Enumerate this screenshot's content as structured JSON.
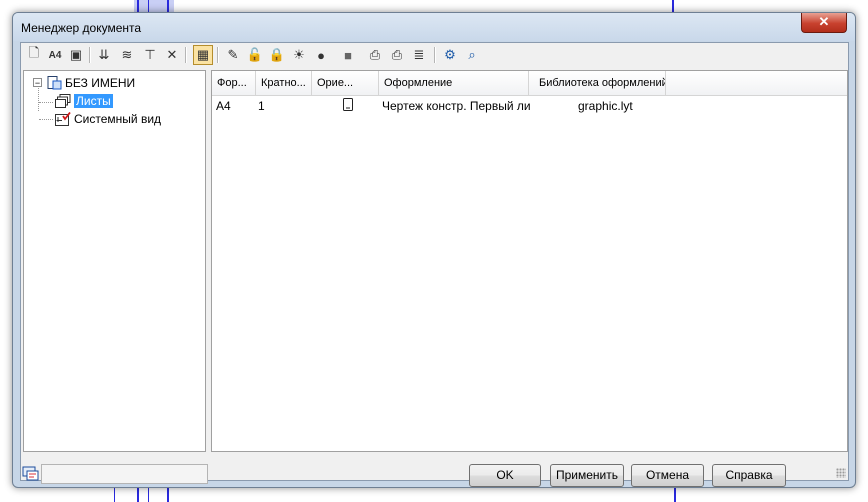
{
  "window": {
    "title": "Менеджер документа",
    "close_glyph": "✕"
  },
  "toolbar": {
    "buttons": [
      {
        "icon": "new-sheet-icon",
        "glyph": "🗋"
      },
      {
        "icon": "sheet-format-icon",
        "glyph": "A4"
      },
      {
        "icon": "sheet-properties-icon",
        "glyph": "▣"
      },
      {
        "icon": "layer-down-icon",
        "glyph": "⇊"
      },
      {
        "icon": "layers-icon",
        "glyph": "≋"
      },
      {
        "icon": "layer-filter-icon",
        "glyph": "⊤"
      },
      {
        "icon": "delete-icon",
        "glyph": "✕"
      },
      {
        "icon": "panel-view-icon",
        "glyph": "▦"
      },
      {
        "icon": "edit-pencil-icon",
        "glyph": "✎"
      },
      {
        "icon": "unlock-icon",
        "glyph": "🔓"
      },
      {
        "icon": "lock-icon",
        "glyph": "🔒"
      },
      {
        "icon": "bulb-on-icon",
        "glyph": "☀"
      },
      {
        "icon": "bulb-off-icon",
        "glyph": "●"
      },
      {
        "icon": "color-icon",
        "glyph": "■"
      },
      {
        "icon": "print-icon",
        "glyph": "⎙"
      },
      {
        "icon": "print-all-icon",
        "glyph": "⎙"
      },
      {
        "icon": "stack-icon",
        "glyph": "≣"
      },
      {
        "icon": "view-settings-icon",
        "glyph": "⚙"
      },
      {
        "icon": "zoom-icon",
        "glyph": "⌕"
      }
    ]
  },
  "tree": {
    "root": {
      "label": "БЕЗ ИМЕНИ",
      "expander": "−"
    },
    "children": [
      {
        "label": "Листы",
        "selected": true
      },
      {
        "label": "Системный вид",
        "selected": false
      }
    ]
  },
  "table": {
    "columns": [
      "Фор...",
      "Кратно...",
      "Орие...",
      "Оформление",
      "Библиотека оформлений"
    ],
    "rows": [
      {
        "format": "A4",
        "multiplicity": "1",
        "orientation_icon": "portrait-page-icon",
        "design": "Чертеж констр. Первый ли",
        "library": "graphic.lyt"
      }
    ]
  },
  "status": {
    "text": ""
  },
  "buttons": {
    "ok": "OK",
    "apply": "Применить",
    "cancel": "Отмена",
    "help": "Справка"
  }
}
